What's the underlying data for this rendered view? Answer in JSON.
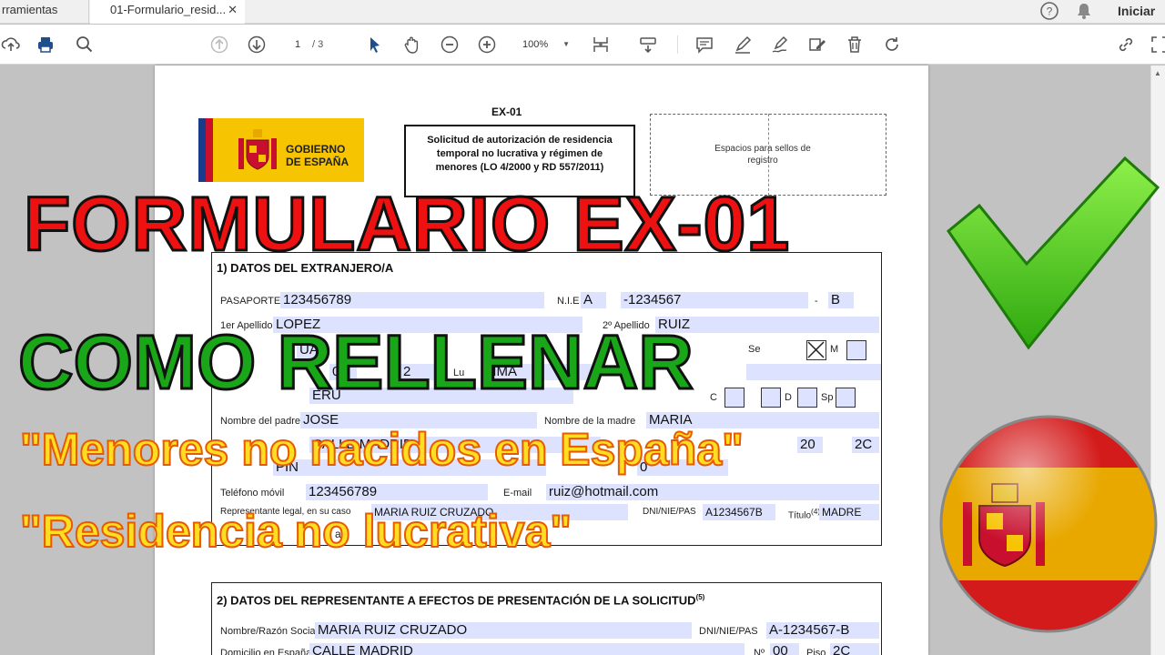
{
  "tabs": {
    "tools": "rramientas",
    "doc": "01-Formulario_resid...",
    "close": "✕"
  },
  "header": {
    "signin": "Iniciar"
  },
  "toolbar": {
    "page": "1",
    "total": "/ 3",
    "zoom": "100%"
  },
  "doc": {
    "code": "EX-01",
    "title": "Solicitud de autorización de residencia temporal no lucrativa y régimen de menores (LO 4/2000 y RD 557/2011)",
    "gob": "GOBIERNO DE ESPAÑA",
    "stamp": "Espacios para sellos de registro",
    "section1": "1)  DATOS DEL EXTRANJERO/A",
    "section2": "2)  DATOS DEL REPRESENTANTE A EFECTOS DE PRESENTACIÓN DE LA SOLICITUD",
    "section2_sup": "(5)",
    "fields": {
      "pasaporte_lbl": "PASAPORTE",
      "pasaporte": "123456789",
      "nie_lbl": "N.I.E",
      "nie_a": "A",
      "nie_num": "-1234567",
      "nie_dash": "-",
      "nie_b": "B",
      "ap1_lbl": "1er Apellido",
      "ap1": "LOPEZ",
      "ap2_lbl": "2º Apellido",
      "ap2": "RUIZ",
      "nombre_frag": "UA",
      "sexo_frag": "Se",
      "sexo_m": "M",
      "fecha_d": "01",
      "fecha_y": "2",
      "lugar_frag": "Lu",
      "lugar": "LIMA",
      "nac_frag": "ERU",
      "civil_c": "C",
      "civil_d": "D",
      "civil_sp": "Sp",
      "padre_lbl": "Nombre del padre",
      "padre": "JOSE",
      "madre_lbl": "Nombre de la madre",
      "madre": "MARIA",
      "dom_frag": "CALLE MADRID",
      "num_frag": "20",
      "piso_frag": "2C",
      "loc_frag": "PIN",
      "cp_frag": "0",
      "movil_lbl": "Teléfono móvil",
      "movil": "123456789",
      "email_lbl": "E-mail",
      "email": "ruiz@hotmail.com",
      "rep_lbl": "Representante legal, en su caso",
      "rep": "MARIA RUIZ CRUZADO",
      "dni_lbl": "DNI/NIE/PAS",
      "dni": "A1234567B",
      "titulo_lbl": "Título",
      "titulo_sup": "(4)",
      "titulo": "MADRE",
      "rep_frag": "a s",
      "razon_lbl": "Nombre/Razón Social",
      "razon": "MARIA RUIZ CRUZADO",
      "dni2_lbl": "DNI/NIE/PAS",
      "dni2": "A-1234567-B",
      "dom2_lbl": "Domicilio en España",
      "dom2": "CALLE MADRID",
      "n2_lbl": "Nº",
      "n2": "00",
      "piso2_lbl": "Piso",
      "piso2": "2C"
    }
  },
  "overlay": {
    "line1": "FORMULARIO EX-01",
    "line2": "COMO RELLENAR",
    "line3": "\"Menores no nacidos en España\"",
    "line4": "\"Residencia no lucrativa\""
  },
  "colors": {
    "red": "#ee1111",
    "green": "#19a619",
    "yellow": "#ffdd22",
    "field": "#dde3ff"
  }
}
